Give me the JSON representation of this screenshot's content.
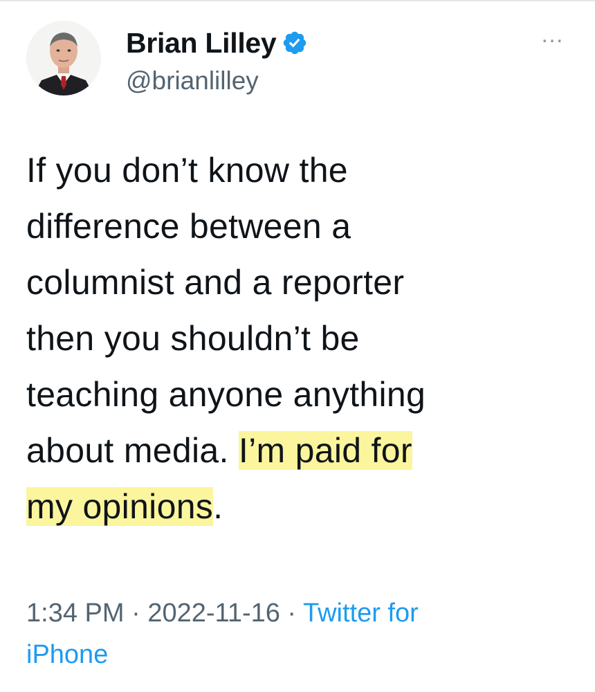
{
  "author": {
    "name": "Brian Lilley",
    "handle": "@brianlilley",
    "verified": true,
    "avatar_icon": "profile-photo"
  },
  "more_icon": "…",
  "tweet": {
    "lines": [
      "If you don’t know the",
      "difference between a",
      "columnist and a reporter",
      "then you shouldn’t be",
      "teaching anyone anything"
    ],
    "line6_plain": "about media. ",
    "line6_highlight": "I’m paid for",
    "line7_highlight": "my opinions",
    "line7_tail": "."
  },
  "meta": {
    "time": "1:34 PM",
    "sep1": " · ",
    "date": "2022-11-16",
    "sep2": " · ",
    "source_line1": "Twitter for",
    "source_line2": "iPhone"
  },
  "colors": {
    "verified_blue": "#1d9bf0",
    "highlight": "#fbf59d",
    "meta_gray": "#536471"
  }
}
